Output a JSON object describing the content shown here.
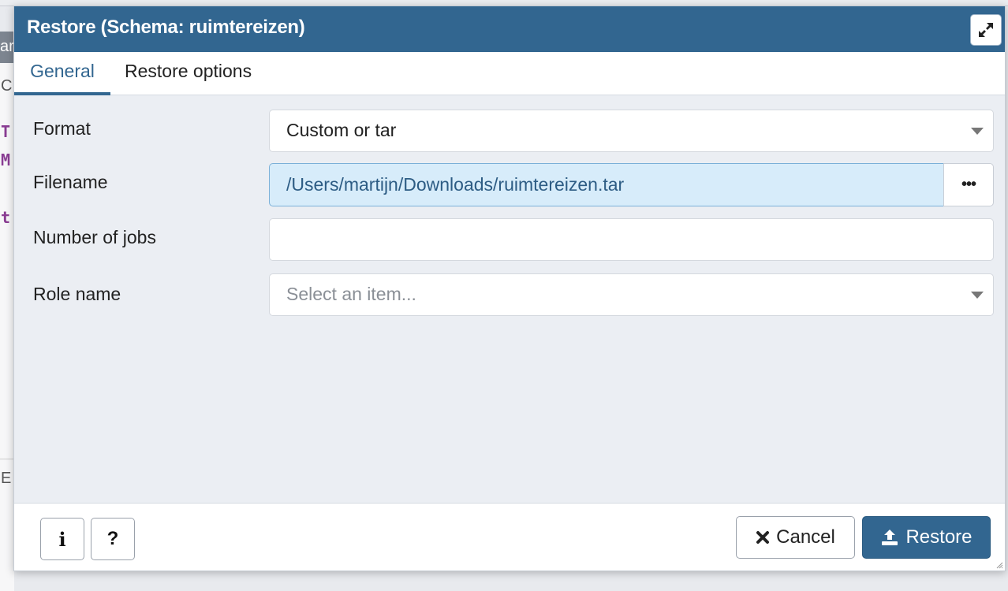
{
  "dialog": {
    "title": "Restore (Schema: ruimtereizen)",
    "tabs": [
      {
        "label": "General",
        "active": true
      },
      {
        "label": "Restore options",
        "active": false
      }
    ]
  },
  "form": {
    "format": {
      "label": "Format",
      "value": "Custom or tar"
    },
    "filename": {
      "label": "Filename",
      "value": "/Users/martijn/Downloads/ruimtereizen.tar",
      "browse_label": "•••"
    },
    "jobs": {
      "label": "Number of jobs",
      "value": ""
    },
    "role": {
      "label": "Role name",
      "placeholder": "Select an item..."
    }
  },
  "footer": {
    "info_label": "i",
    "help_label": "?",
    "cancel_label": "Cancel",
    "restore_label": "Restore"
  },
  "background": {
    "left_chars": [
      "ar",
      "C",
      "T",
      "M",
      "t",
      "E"
    ]
  },
  "colors": {
    "titlebar": "#326690",
    "accent": "#326690",
    "selected_input": "#d7ecfa"
  }
}
